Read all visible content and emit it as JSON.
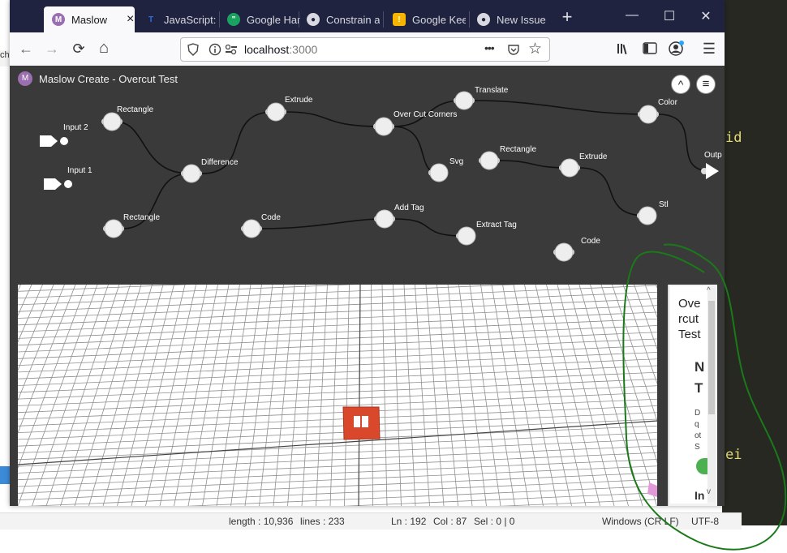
{
  "background_editor": {
    "code_fragments": [
      "id",
      "ei"
    ],
    "left_fragment": "ch",
    "status": {
      "length": "length : 10,936",
      "lines": "lines : 233",
      "ln": "Ln : 192",
      "col": "Col : 87",
      "sel": "Sel : 0 | 0",
      "eol": "Windows (CR LF)",
      "encoding": "UTF-8"
    }
  },
  "browser": {
    "tabs": [
      {
        "label": "Maslow",
        "icon": "maslow-icon",
        "active": true
      },
      {
        "label": "JavaScript: l",
        "icon": "javascript-icon",
        "active": false
      },
      {
        "label": "Google Han",
        "icon": "hangouts-icon",
        "active": false
      },
      {
        "label": "Constrain a",
        "icon": "github-icon",
        "active": false
      },
      {
        "label": "Google Kee",
        "icon": "keep-icon",
        "active": false
      },
      {
        "label": "New Issue",
        "icon": "github-icon",
        "active": false
      }
    ],
    "new_tab": "+",
    "tab_close": "×",
    "url_host": "localhost",
    "url_port": ":3000",
    "window_controls": {
      "minimize": "—",
      "maximize": "☐",
      "close": "✕"
    },
    "toolbar_glyphs": {
      "back": "←",
      "forward": "→",
      "reload": "⟳",
      "home": "⌂",
      "more": "•••",
      "bookmark": "☆",
      "menu": "☰"
    }
  },
  "app": {
    "title": "Maslow Create  - Overcut Test",
    "logo": "M",
    "buttons": {
      "up": "^",
      "menu": "≡"
    },
    "nodes": [
      {
        "label": "Input 2"
      },
      {
        "label": "Input 1"
      },
      {
        "label": "Rectangle"
      },
      {
        "label": "Rectangle"
      },
      {
        "label": "Difference"
      },
      {
        "label": "Extrude"
      },
      {
        "label": "Over Cut Corners"
      },
      {
        "label": "Translate"
      },
      {
        "label": "Color"
      },
      {
        "label": "Outp"
      },
      {
        "label": "Svg"
      },
      {
        "label": "Rectangle"
      },
      {
        "label": "Extrude"
      },
      {
        "label": "Stl"
      },
      {
        "label": "Code"
      },
      {
        "label": "Add Tag"
      },
      {
        "label": "Extract Tag"
      },
      {
        "label": "Code"
      }
    ],
    "side_panel": {
      "title": "Overcut Test",
      "subtitle_line1": "N",
      "subtitle_line2": "T",
      "desc_lines": [
        "D",
        "q",
        "ot",
        "S"
      ],
      "footer": "In",
      "scroll_up": "^",
      "scroll_down": "v"
    }
  },
  "colors": {
    "tabbar": "#202340",
    "app_bg": "#3a3a3a",
    "node": "#ffffff",
    "part": "#d9482b",
    "annotation": "#1a7a1a"
  }
}
